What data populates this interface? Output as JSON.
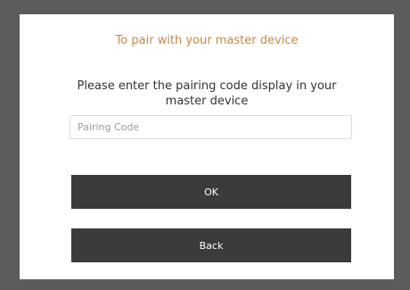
{
  "dialog": {
    "title": "To pair with your master device",
    "instruction": "Please enter the pairing code display in your master device",
    "pairing_input": {
      "value": "",
      "placeholder": "Pairing Code"
    },
    "ok_label": "OK",
    "back_label": "Back"
  },
  "colors": {
    "title": "#c08a48",
    "button_bg": "#3b3b3b",
    "frame_bg": "#5c5c5c"
  }
}
